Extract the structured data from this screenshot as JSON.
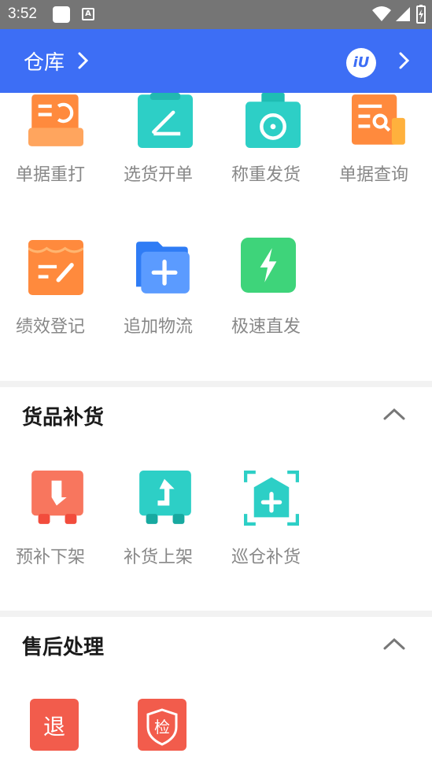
{
  "status_bar": {
    "time": "3:52",
    "a_label": "A"
  },
  "header": {
    "title": "仓库",
    "logo_text": "iU"
  },
  "top_grid": [
    {
      "label": "单据重打",
      "icon": "reprint-icon"
    },
    {
      "label": "选货开单",
      "icon": "select-order-icon"
    },
    {
      "label": "称重发货",
      "icon": "scale-icon"
    },
    {
      "label": "单据查询",
      "icon": "doc-search-icon"
    },
    {
      "label": "绩效登记",
      "icon": "performance-icon"
    },
    {
      "label": "追加物流",
      "icon": "add-logistics-icon"
    },
    {
      "label": "极速直发",
      "icon": "flash-ship-icon"
    }
  ],
  "sections": [
    {
      "title": "货品补货",
      "items": [
        {
          "label": "预补下架",
          "icon": "pre-unshelve-icon"
        },
        {
          "label": "补货上架",
          "icon": "restock-shelve-icon"
        },
        {
          "label": "巡仓补货",
          "icon": "patrol-restock-icon"
        }
      ]
    },
    {
      "title": "售后处理",
      "items": [
        {
          "label": "退",
          "icon": "return-icon"
        },
        {
          "label": "检",
          "icon": "inspect-icon"
        }
      ]
    }
  ],
  "colors": {
    "header": "#3d6ef5",
    "orange": "#ff8a3d",
    "teal": "#2dcfc6",
    "blue": "#3f7bf5",
    "green": "#3ed47a",
    "red": "#f25c4c"
  }
}
